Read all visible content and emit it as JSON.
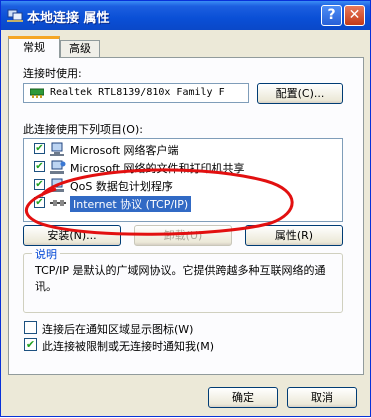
{
  "window": {
    "title": "本地连接 属性",
    "help_label": "?",
    "close_label": "✕"
  },
  "tabs": [
    {
      "label": "常规",
      "active": true
    },
    {
      "label": "高级",
      "active": false
    }
  ],
  "connect_using": {
    "label": "连接时使用:",
    "adapter": "Realtek RTL8139/810x Family F",
    "configure_button": "配置(C)..."
  },
  "items_section": {
    "label": "此连接使用下列项目(O):",
    "items": [
      {
        "label": "Microsoft 网络客户端",
        "checked": true,
        "icon": "network-client-icon"
      },
      {
        "label": "Microsoft 网络的文件和打印机共享",
        "checked": true,
        "icon": "file-printer-sharing-icon"
      },
      {
        "label": "QoS 数据包计划程序",
        "checked": true,
        "icon": "qos-scheduler-icon"
      },
      {
        "label": "Internet 协议 (TCP/IP)",
        "checked": true,
        "selected": true,
        "icon": "protocol-icon"
      }
    ]
  },
  "buttons": {
    "install": "安装(N)...",
    "uninstall": "卸载(U)",
    "properties": "属性(R)"
  },
  "description": {
    "title": "说明",
    "text": "TCP/IP 是默认的广域网协议。它提供跨越多种互联网络的通讯。"
  },
  "options": [
    {
      "label": "连接后在通知区域显示图标(W)",
      "checked": false
    },
    {
      "label": "此连接被限制或无连接时通知我(M)",
      "checked": true
    }
  ],
  "footer": {
    "ok": "确定",
    "cancel": "取消"
  },
  "colors": {
    "titlebar": "#0a4fd6",
    "selection": "#316ac5",
    "annotation": "#e21010",
    "check": "#21a121"
  }
}
